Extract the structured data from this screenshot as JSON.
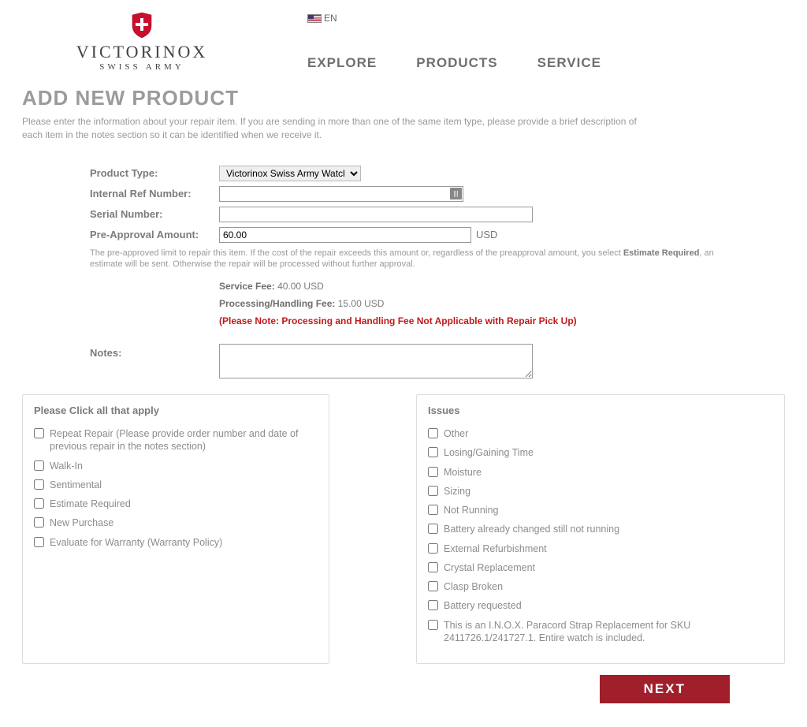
{
  "brand": {
    "line1": "VICTORINOX",
    "line2": "SWISS ARMY"
  },
  "lang": "EN",
  "nav": {
    "explore": "EXPLORE",
    "products": "PRODUCTS",
    "service": "SERVICE"
  },
  "page_title": "ADD NEW PRODUCT",
  "intro": "Please enter the information about your repair item. If you are sending in more than one of the same item type, please provide a brief description of each item in the notes section so it can be identified when we receive it.",
  "labels": {
    "product_type": "Product Type:",
    "internal_ref": "Internal Ref Number:",
    "serial": "Serial Number:",
    "preapproval": "Pre-Approval Amount:",
    "notes": "Notes:"
  },
  "product_type_value": "Victorinox Swiss Army Watch",
  "preapproval_value": "60.00",
  "currency": "USD",
  "preapproval_fine_pre": "The pre-approved limit to repair this item. If the cost of the repair exceeds this amount or, regardless of the preapproval amount, you select ",
  "preapproval_fine_bold": "Estimate Required",
  "preapproval_fine_post": ", an estimate will be sent. Otherwise the repair will be processed without further approval.",
  "service_fee_label": "Service Fee:",
  "service_fee_value": "40.00 USD",
  "proc_fee_label": "Processing/Handling Fee:",
  "proc_fee_value": "15.00 USD",
  "fee_note": "(Please Note: Processing and Handling Fee Not Applicable with Repair Pick Up)",
  "apply_header": "Please Click all that apply",
  "apply_items": [
    "Repeat Repair (Please provide order number and date of previous repair in the notes section)",
    "Walk-In",
    "Sentimental",
    "Estimate Required",
    "New Purchase",
    "Evaluate for Warranty (Warranty Policy)"
  ],
  "issues_header": "Issues",
  "issues_items": [
    "Other",
    "Losing/Gaining Time",
    "Moisture",
    "Sizing",
    "Not Running",
    "Battery already changed still not running",
    "External Refurbishment",
    "Crystal Replacement",
    "Clasp Broken",
    "Battery requested",
    "This is an I.N.O.X. Paracord Strap Replacement for SKU 2411726.1/241727.1. Entire watch is included."
  ],
  "next_label": "NEXT"
}
